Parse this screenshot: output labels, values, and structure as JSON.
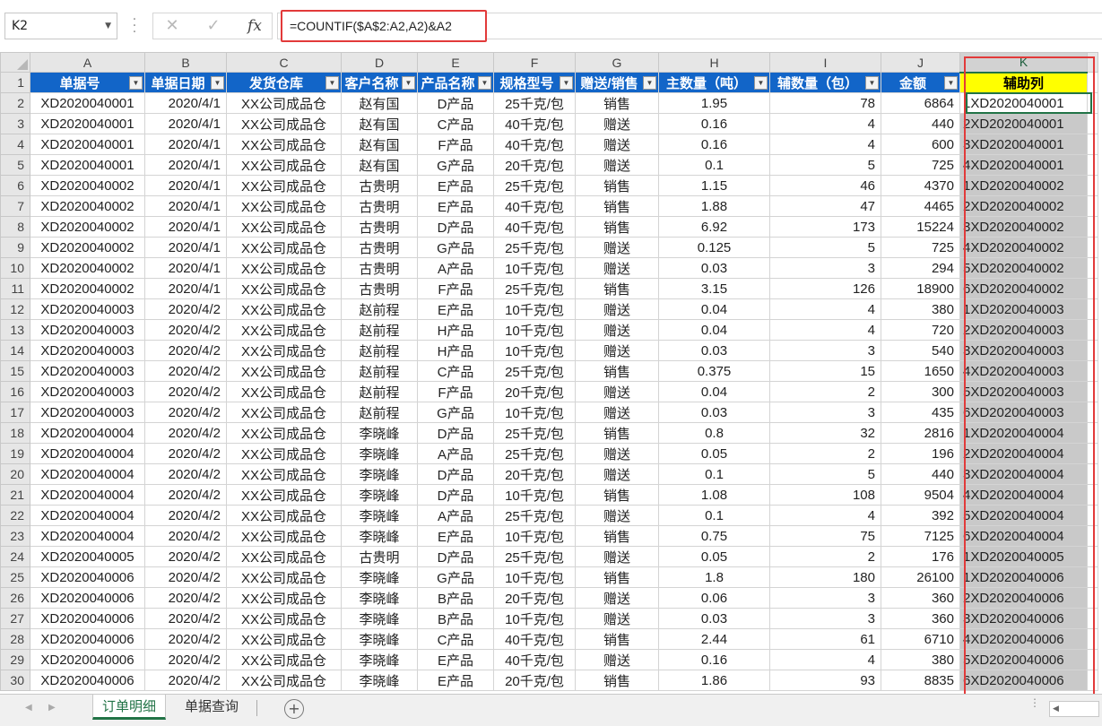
{
  "name_box": "K2",
  "formula": "=COUNTIF($A$2:A2,A2)&A2",
  "formula_buttons": {
    "cancel": "✕",
    "enter": "✓",
    "fx": "fx"
  },
  "column_letters": [
    "A",
    "B",
    "C",
    "D",
    "E",
    "F",
    "G",
    "H",
    "I",
    "J",
    "K"
  ],
  "headers": [
    "单据号",
    "单据日期",
    "发货仓库",
    "客户名称",
    "产品名称",
    "规格型号",
    "赠送/销售",
    "主数量（吨）",
    "辅数量（包）",
    "金额",
    "辅助列"
  ],
  "rows": [
    [
      "XD2020040001",
      "2020/4/1",
      "XX公司成品仓",
      "赵有国",
      "D产品",
      "25千克/包",
      "销售",
      "1.95",
      "78",
      "6864",
      "1XD2020040001"
    ],
    [
      "XD2020040001",
      "2020/4/1",
      "XX公司成品仓",
      "赵有国",
      "C产品",
      "40千克/包",
      "赠送",
      "0.16",
      "4",
      "440",
      "2XD2020040001"
    ],
    [
      "XD2020040001",
      "2020/4/1",
      "XX公司成品仓",
      "赵有国",
      "F产品",
      "40千克/包",
      "赠送",
      "0.16",
      "4",
      "600",
      "3XD2020040001"
    ],
    [
      "XD2020040001",
      "2020/4/1",
      "XX公司成品仓",
      "赵有国",
      "G产品",
      "20千克/包",
      "赠送",
      "0.1",
      "5",
      "725",
      "4XD2020040001"
    ],
    [
      "XD2020040002",
      "2020/4/1",
      "XX公司成品仓",
      "古贵明",
      "E产品",
      "25千克/包",
      "销售",
      "1.15",
      "46",
      "4370",
      "1XD2020040002"
    ],
    [
      "XD2020040002",
      "2020/4/1",
      "XX公司成品仓",
      "古贵明",
      "E产品",
      "40千克/包",
      "销售",
      "1.88",
      "47",
      "4465",
      "2XD2020040002"
    ],
    [
      "XD2020040002",
      "2020/4/1",
      "XX公司成品仓",
      "古贵明",
      "D产品",
      "40千克/包",
      "销售",
      "6.92",
      "173",
      "15224",
      "3XD2020040002"
    ],
    [
      "XD2020040002",
      "2020/4/1",
      "XX公司成品仓",
      "古贵明",
      "G产品",
      "25千克/包",
      "赠送",
      "0.125",
      "5",
      "725",
      "4XD2020040002"
    ],
    [
      "XD2020040002",
      "2020/4/1",
      "XX公司成品仓",
      "古贵明",
      "A产品",
      "10千克/包",
      "赠送",
      "0.03",
      "3",
      "294",
      "5XD2020040002"
    ],
    [
      "XD2020040002",
      "2020/4/1",
      "XX公司成品仓",
      "古贵明",
      "F产品",
      "25千克/包",
      "销售",
      "3.15",
      "126",
      "18900",
      "6XD2020040002"
    ],
    [
      "XD2020040003",
      "2020/4/2",
      "XX公司成品仓",
      "赵前程",
      "E产品",
      "10千克/包",
      "赠送",
      "0.04",
      "4",
      "380",
      "1XD2020040003"
    ],
    [
      "XD2020040003",
      "2020/4/2",
      "XX公司成品仓",
      "赵前程",
      "H产品",
      "10千克/包",
      "赠送",
      "0.04",
      "4",
      "720",
      "2XD2020040003"
    ],
    [
      "XD2020040003",
      "2020/4/2",
      "XX公司成品仓",
      "赵前程",
      "H产品",
      "10千克/包",
      "赠送",
      "0.03",
      "3",
      "540",
      "3XD2020040003"
    ],
    [
      "XD2020040003",
      "2020/4/2",
      "XX公司成品仓",
      "赵前程",
      "C产品",
      "25千克/包",
      "销售",
      "0.375",
      "15",
      "1650",
      "4XD2020040003"
    ],
    [
      "XD2020040003",
      "2020/4/2",
      "XX公司成品仓",
      "赵前程",
      "F产品",
      "20千克/包",
      "赠送",
      "0.04",
      "2",
      "300",
      "5XD2020040003"
    ],
    [
      "XD2020040003",
      "2020/4/2",
      "XX公司成品仓",
      "赵前程",
      "G产品",
      "10千克/包",
      "赠送",
      "0.03",
      "3",
      "435",
      "6XD2020040003"
    ],
    [
      "XD2020040004",
      "2020/4/2",
      "XX公司成品仓",
      "李晓峰",
      "D产品",
      "25千克/包",
      "销售",
      "0.8",
      "32",
      "2816",
      "1XD2020040004"
    ],
    [
      "XD2020040004",
      "2020/4/2",
      "XX公司成品仓",
      "李晓峰",
      "A产品",
      "25千克/包",
      "赠送",
      "0.05",
      "2",
      "196",
      "2XD2020040004"
    ],
    [
      "XD2020040004",
      "2020/4/2",
      "XX公司成品仓",
      "李晓峰",
      "D产品",
      "20千克/包",
      "赠送",
      "0.1",
      "5",
      "440",
      "3XD2020040004"
    ],
    [
      "XD2020040004",
      "2020/4/2",
      "XX公司成品仓",
      "李晓峰",
      "D产品",
      "10千克/包",
      "销售",
      "1.08",
      "108",
      "9504",
      "4XD2020040004"
    ],
    [
      "XD2020040004",
      "2020/4/2",
      "XX公司成品仓",
      "李晓峰",
      "A产品",
      "25千克/包",
      "赠送",
      "0.1",
      "4",
      "392",
      "5XD2020040004"
    ],
    [
      "XD2020040004",
      "2020/4/2",
      "XX公司成品仓",
      "李晓峰",
      "E产品",
      "10千克/包",
      "销售",
      "0.75",
      "75",
      "7125",
      "6XD2020040004"
    ],
    [
      "XD2020040005",
      "2020/4/2",
      "XX公司成品仓",
      "古贵明",
      "D产品",
      "25千克/包",
      "赠送",
      "0.05",
      "2",
      "176",
      "1XD2020040005"
    ],
    [
      "XD2020040006",
      "2020/4/2",
      "XX公司成品仓",
      "李晓峰",
      "G产品",
      "10千克/包",
      "销售",
      "1.8",
      "180",
      "26100",
      "1XD2020040006"
    ],
    [
      "XD2020040006",
      "2020/4/2",
      "XX公司成品仓",
      "李晓峰",
      "B产品",
      "20千克/包",
      "赠送",
      "0.06",
      "3",
      "360",
      "2XD2020040006"
    ],
    [
      "XD2020040006",
      "2020/4/2",
      "XX公司成品仓",
      "李晓峰",
      "B产品",
      "10千克/包",
      "赠送",
      "0.03",
      "3",
      "360",
      "3XD2020040006"
    ],
    [
      "XD2020040006",
      "2020/4/2",
      "XX公司成品仓",
      "李晓峰",
      "C产品",
      "40千克/包",
      "销售",
      "2.44",
      "61",
      "6710",
      "4XD2020040006"
    ],
    [
      "XD2020040006",
      "2020/4/2",
      "XX公司成品仓",
      "李晓峰",
      "E产品",
      "40千克/包",
      "赠送",
      "0.16",
      "4",
      "380",
      "5XD2020040006"
    ],
    [
      "XD2020040006",
      "2020/4/2",
      "XX公司成品仓",
      "李晓峰",
      "E产品",
      "20千克/包",
      "销售",
      "1.86",
      "93",
      "8835",
      "6XD2020040006"
    ]
  ],
  "sheet_tabs": [
    "订单明细",
    "单据查询"
  ],
  "add_sheet": "+",
  "colors": {
    "header_blue": "#1265c8",
    "aux_yellow": "#ffff00",
    "highlight_red": "#e23a3a",
    "excel_green": "#217346"
  }
}
